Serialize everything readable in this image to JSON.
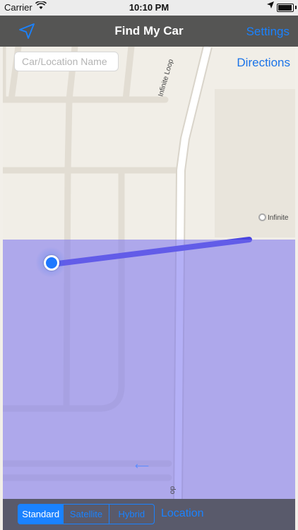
{
  "status_bar": {
    "carrier": "Carrier",
    "time": "10:10 PM",
    "icons": [
      "wifi-icon",
      "location-arrow-icon",
      "battery-icon"
    ]
  },
  "nav_bar": {
    "title": "Find My Car",
    "settings_label": "Settings",
    "left_icon": "location-arrow-icon"
  },
  "map": {
    "search_placeholder": "Car/Location Name",
    "search_value": "",
    "directions_label": "Directions",
    "road_label": "Infinite Loop",
    "poi_label": "Infinite",
    "road_label_bottom": "op",
    "route_color": "#4a45e0",
    "overlay_color": "#7670ee",
    "user_dot_color": "#1e78ff"
  },
  "bottom_bar": {
    "map_types": [
      "Standard",
      "Satellite",
      "Hybrid"
    ],
    "selected_map_type": "Standard",
    "location_label": "Location",
    "accent_color": "#1a82ff"
  }
}
